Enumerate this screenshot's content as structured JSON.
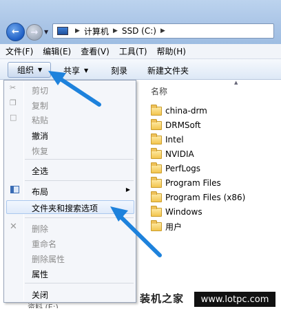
{
  "address_bar": {
    "segments": [
      "计算机",
      "SSD (C:)"
    ]
  },
  "menu_bar": {
    "items": [
      "文件(F)",
      "编辑(E)",
      "查看(V)",
      "工具(T)",
      "帮助(H)"
    ]
  },
  "command_bar": {
    "organize": "组织",
    "share": "共享",
    "burn": "刻录",
    "new_folder": "新建文件夹"
  },
  "file_list": {
    "column_name": "名称",
    "items": [
      "china-drm",
      "DRMSoft",
      "Intel",
      "NVIDIA",
      "PerfLogs",
      "Program Files",
      "Program Files (x86)",
      "Windows",
      "用户"
    ]
  },
  "organize_menu": {
    "cut": "剪切",
    "copy": "复制",
    "paste": "粘贴",
    "undo": "撤消",
    "redo": "恢复",
    "select_all": "全选",
    "layout": "布局",
    "folder_options": "文件夹和搜索选项",
    "delete": "删除",
    "rename": "重命名",
    "remove_properties": "删除属性",
    "properties": "属性",
    "close": "关闭"
  },
  "drive_partial": "资料 (E:)",
  "watermark": {
    "site_name": "装机之家",
    "url": "www.lotpc.com"
  },
  "colors": {
    "arrow": "#1e82dc",
    "highlight_border": "#a9c7ee"
  }
}
